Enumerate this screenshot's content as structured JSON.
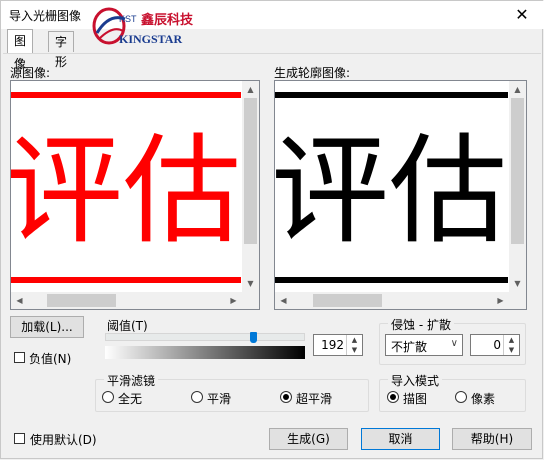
{
  "window": {
    "title": "导入光栅图像",
    "close": "✕"
  },
  "logo": {
    "kst": "KST",
    "cn": "鑫辰科技",
    "en": "KINGSTAR"
  },
  "tabs": [
    {
      "label": "图像"
    },
    {
      "label": "字形"
    }
  ],
  "source": {
    "label": "源图像:",
    "text": "评估",
    "color": "#ff0000"
  },
  "outline": {
    "label": "生成轮廓图像:",
    "text": "评估",
    "color": "#000000"
  },
  "load_button": "加载(L)...",
  "negative": {
    "label": "负值(N)",
    "checked": false
  },
  "threshold": {
    "title": "阈值(T)",
    "value": "192",
    "max": 255
  },
  "erode": {
    "title": "侵蚀 - 扩散",
    "mode": "不扩散",
    "value": "0"
  },
  "smoothing": {
    "title": "平滑滤镜",
    "options": [
      {
        "label": "全无",
        "checked": false
      },
      {
        "label": "平滑",
        "checked": false
      },
      {
        "label": "超平滑",
        "checked": true
      }
    ]
  },
  "import_mode": {
    "title": "导入模式",
    "options": [
      {
        "label": "描图",
        "checked": true
      },
      {
        "label": "像素",
        "checked": false
      }
    ]
  },
  "use_default": {
    "label": "使用默认(D)",
    "checked": false
  },
  "buttons": {
    "generate": "生成(G)",
    "cancel": "取消",
    "help": "帮助(H)"
  },
  "icons": {
    "up": "▲",
    "down": "▼",
    "left": "◀",
    "right": "▶",
    "chevron": "∨"
  }
}
